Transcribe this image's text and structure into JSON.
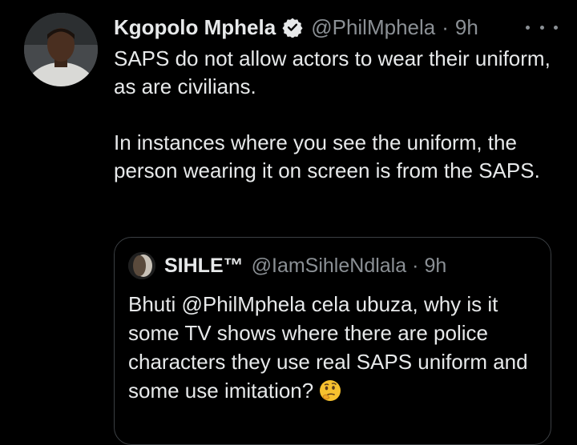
{
  "tweet": {
    "display_name": "Kgopolo Mphela",
    "handle": "@PhilMphela",
    "separator": "·",
    "time": "9h",
    "paragraphs": [
      "SAPS do not allow actors to wear their uniform, as are civilians.",
      "In instances where you see the uniform, the person wearing it on screen is from the SAPS."
    ],
    "verified_icon": "verified-badge-icon",
    "more_icon": "more-options-icon"
  },
  "quoted_tweet": {
    "display_name": "SIHLE™",
    "handle": "@IamSihleNdlala",
    "separator": "·",
    "time": "9h",
    "text": "Bhuti @PhilMphela cela ubuza,  why is it some TV shows where there are police characters they use real SAPS uniform and some use imitation?",
    "emoji": "thinking-face-emoji"
  },
  "colors": {
    "background": "#000000",
    "primary_text": "#e7e9ea",
    "secondary_text": "#8b9095",
    "quote_border": "#3b3f43"
  }
}
